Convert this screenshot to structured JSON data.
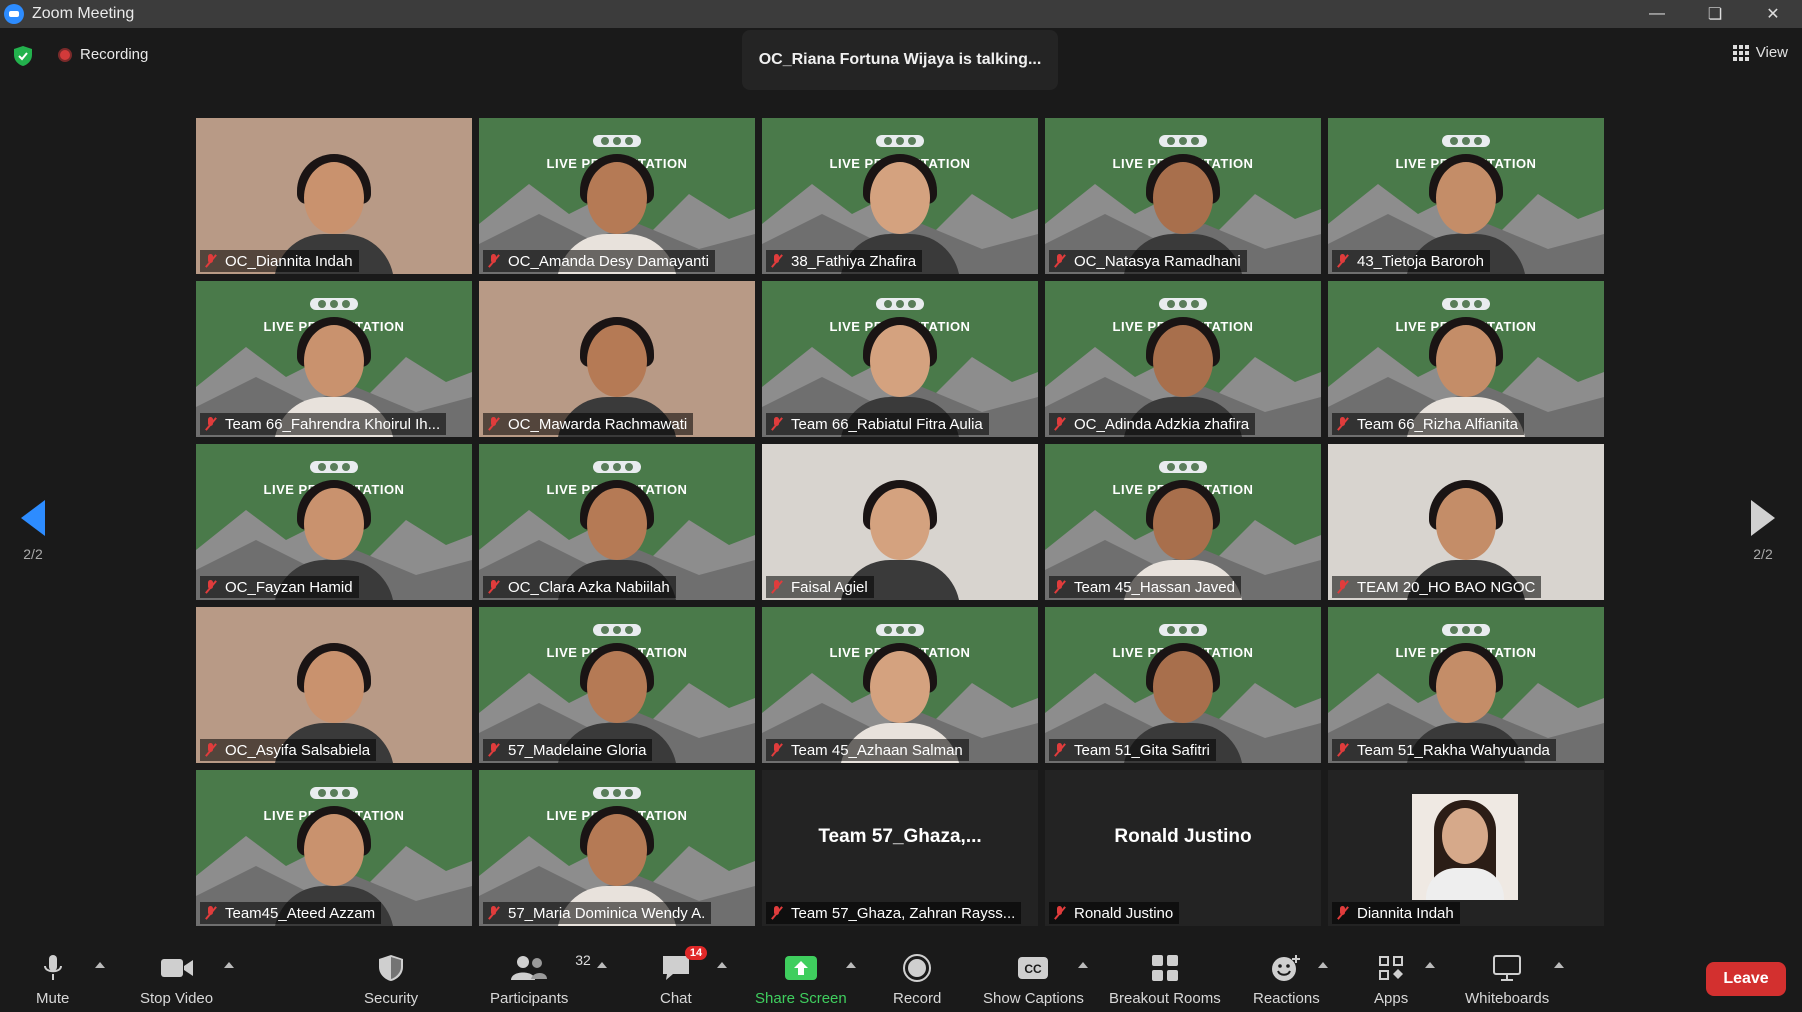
{
  "window": {
    "title": "Zoom Meeting",
    "controls": [
      "minimize",
      "restore",
      "close"
    ]
  },
  "header": {
    "recording_label": "Recording",
    "talking_banner": "OC_Riana Fortuna Wijaya is talking...",
    "view_label": "View"
  },
  "pagination": {
    "left": "2/2",
    "right": "2/2"
  },
  "background_banner": "LIVE PRESENTATION",
  "tiles": [
    {
      "name": "OC_Diannita Indah",
      "kind": "photo"
    },
    {
      "name": "OC_Amanda Desy Damayanti",
      "kind": "green"
    },
    {
      "name": "38_Fathiya Zhafira",
      "kind": "green"
    },
    {
      "name": "OC_Natasya Ramadhani",
      "kind": "green"
    },
    {
      "name": "43_Tietoja Baroroh",
      "kind": "green"
    },
    {
      "name": "Team 66_Fahrendra Khoirul Ih...",
      "kind": "green"
    },
    {
      "name": "OC_Mawarda Rachmawati",
      "kind": "photo"
    },
    {
      "name": "Team 66_Rabiatul Fitra Aulia",
      "kind": "green"
    },
    {
      "name": "OC_Adinda Adzkia zhafira",
      "kind": "green"
    },
    {
      "name": "Team 66_Rizha Alfianita",
      "kind": "green"
    },
    {
      "name": "OC_Fayzan Hamid",
      "kind": "green"
    },
    {
      "name": "OC_Clara Azka Nabiilah",
      "kind": "green"
    },
    {
      "name": "Faisal Agiel",
      "kind": "photo2"
    },
    {
      "name": "Team 45_Hassan Javed",
      "kind": "green"
    },
    {
      "name": "TEAM 20_HO BAO NGOC",
      "kind": "photo2"
    },
    {
      "name": "OC_Asyifa Salsabiela",
      "kind": "photo"
    },
    {
      "name": "57_Madelaine Gloria",
      "kind": "green"
    },
    {
      "name": "Team 45_Azhaan Salman",
      "kind": "green"
    },
    {
      "name": "Team 51_Gita Safitri",
      "kind": "green"
    },
    {
      "name": "Team 51_Rakha Wahyuanda",
      "kind": "green"
    },
    {
      "name": "Team45_Ateed Azzam",
      "kind": "green"
    },
    {
      "name": "57_Maria Dominica Wendy A.",
      "kind": "green"
    },
    {
      "name": "Team 57_Ghaza, Zahran Rayss...",
      "kind": "dark",
      "display_name": "Team  57_Ghaza,..."
    },
    {
      "name": "Ronald Justino",
      "kind": "dark",
      "display_name": "Ronald Justino"
    },
    {
      "name": "Diannita Indah",
      "kind": "avatar"
    }
  ],
  "toolbar": {
    "mute": "Mute",
    "stop_video": "Stop Video",
    "security": "Security",
    "participants": "Participants",
    "participants_count": "32",
    "chat": "Chat",
    "chat_badge": "14",
    "share_screen": "Share Screen",
    "record": "Record",
    "show_captions": "Show Captions",
    "captions_icon_text": "CC",
    "breakout_rooms": "Breakout Rooms",
    "reactions": "Reactions",
    "apps": "Apps",
    "whiteboards": "Whiteboards",
    "leave": "Leave"
  },
  "colors": {
    "accent": "#2d8cff",
    "share_green": "#3fce5e",
    "leave_red": "#d3302f",
    "muted_red": "#e03c3c",
    "backdrop_green": "#4a7a4a"
  }
}
